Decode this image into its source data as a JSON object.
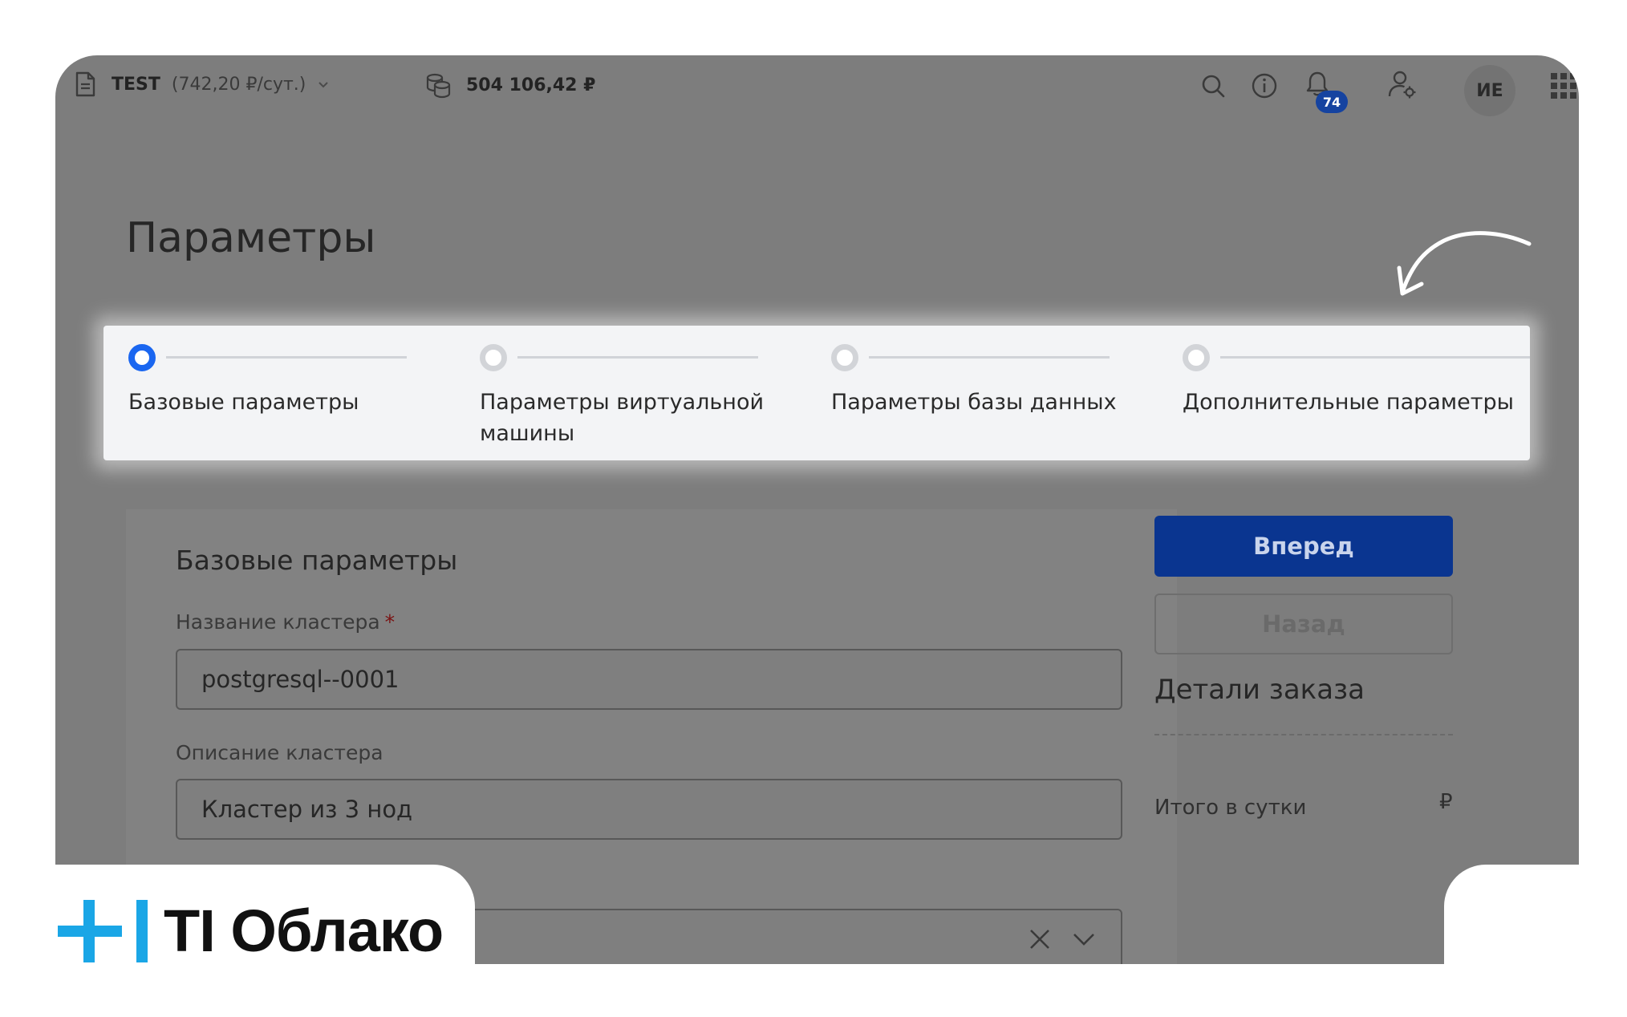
{
  "topbar": {
    "project_name": "TEST",
    "project_rate": "(742,20 ₽/сут.)",
    "balance": "504 106,42 ₽",
    "notifications_count": "74",
    "user_initials": "ИЕ"
  },
  "page_title": "Параметры",
  "stepper": {
    "steps": [
      {
        "label": "Базовые параметры",
        "state": "active"
      },
      {
        "label": "Параметры виртуальной машины",
        "state": "pending"
      },
      {
        "label": "Параметры базы данных",
        "state": "pending"
      },
      {
        "label": "Дополнительные параметры",
        "state": "pending"
      }
    ]
  },
  "form": {
    "section_title": "Базовые параметры",
    "cluster_name_label": "Название кластера",
    "required_mark": "*",
    "cluster_name_value": "postgresql--0001",
    "cluster_desc_label": "Описание кластера",
    "cluster_desc_value": "Кластер из 3 нод"
  },
  "sidebar": {
    "next_button": "Вперед",
    "back_button": "Назад",
    "order_details_title": "Детали заказа",
    "total_per_day_label": "Итого в сутки",
    "total_currency": "₽"
  },
  "branding": {
    "logo_text": "TI Облако"
  },
  "colors": {
    "accent_blue": "#1a66f0",
    "primary_button": "#0a3590",
    "logo_cyan": "#1aa6e6",
    "overlay_grey": "#7d7d7d"
  },
  "icons": [
    "document-icon",
    "chevron-down-icon",
    "coins-icon",
    "search-icon",
    "info-icon",
    "bell-icon",
    "user-settings-icon",
    "apps-grid-icon",
    "clear-icon",
    "chevron-down-icon",
    "curved-arrow-icon"
  ]
}
